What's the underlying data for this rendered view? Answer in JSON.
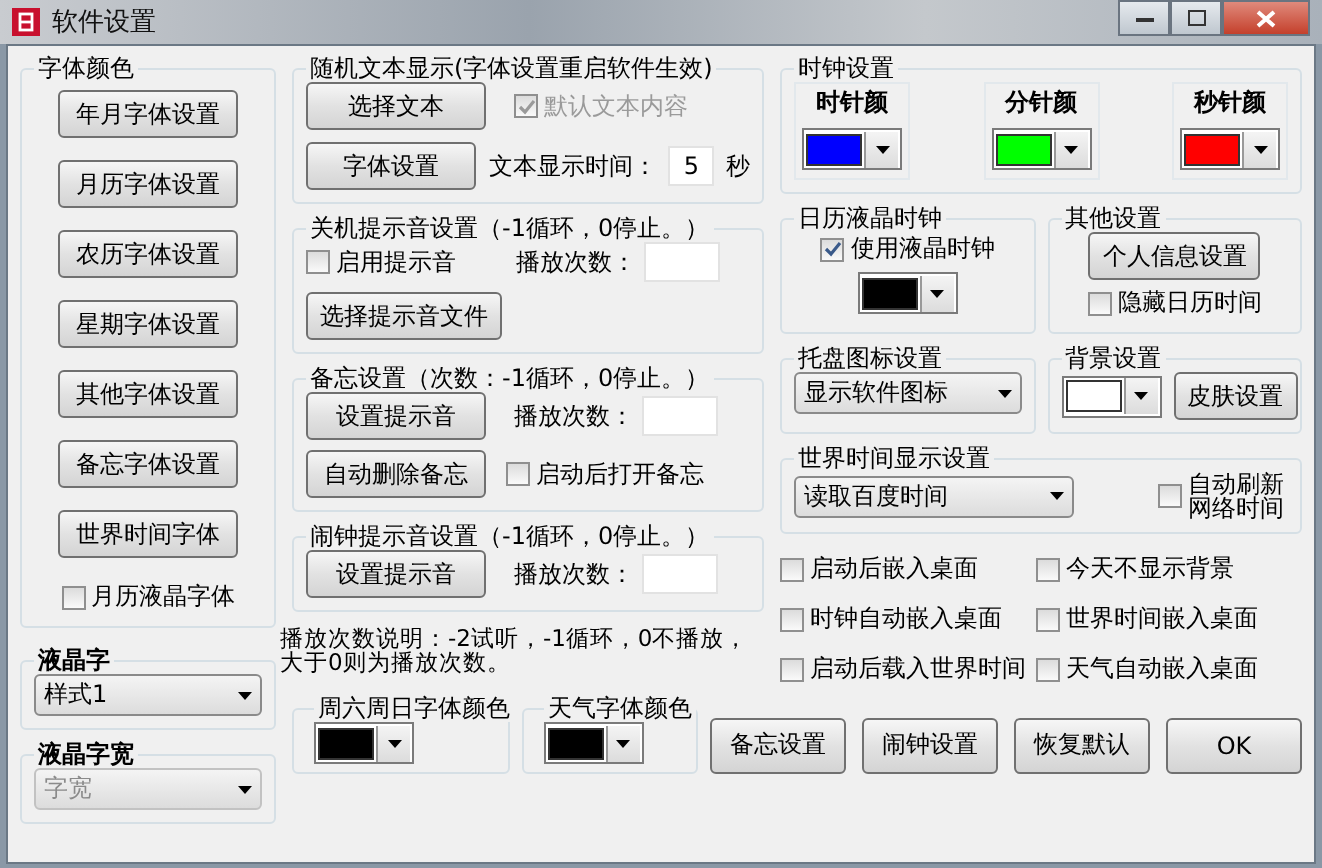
{
  "window": {
    "title": "软件设置"
  },
  "font_color": {
    "title": "字体颜色",
    "buttons": [
      "年月字体设置",
      "月历字体设置",
      "农历字体设置",
      "星期字体设置",
      "其他字体设置",
      "备忘字体设置",
      "世界时间字体"
    ],
    "checkbox": {
      "label": "月历液晶字体",
      "checked": false
    }
  },
  "lcd_style": {
    "title": "液晶字",
    "value": "样式1"
  },
  "lcd_width": {
    "title": "液晶字宽",
    "value": "字宽",
    "disabled": true
  },
  "random_text": {
    "title": "随机文本显示(字体设置重启软件生效)",
    "select_button": "选择文本",
    "font_button": "字体设置",
    "checkbox": {
      "label": "默认文本内容",
      "checked": true,
      "disabled": true
    },
    "time_label": "文本显示时间：",
    "time_value": "5",
    "unit": "秒"
  },
  "shutdown_sound": {
    "title": "关机提示音设置（-1循环，0停止。）",
    "checkbox": {
      "label": "启用提示音",
      "checked": false
    },
    "count_label": "播放次数：",
    "file_button": "选择提示音文件"
  },
  "memo": {
    "title": "备忘设置（次数：-1循环，0停止。）",
    "sound_button": "设置提示音",
    "count_label": "播放次数：",
    "delete_button": "自动删除备忘",
    "checkbox": {
      "label": "启动后打开备忘",
      "checked": false
    }
  },
  "alarm": {
    "title": "闹钟提示音设置（-1循环，0停止。）",
    "sound_button": "设置提示音",
    "count_label": "播放次数："
  },
  "note": "播放次数说明：-2试听，-1循环，0不播放，大于0则为播放次数。",
  "weekend_color": {
    "title": "周六周日字体颜色",
    "color": "#000000"
  },
  "weather_color": {
    "title": "天气字体颜色",
    "color": "#000000"
  },
  "clock": {
    "title": "时钟设置",
    "hands": [
      {
        "label": "时针颜",
        "color": "#0000ff"
      },
      {
        "label": "分针颜",
        "color": "#00ff00"
      },
      {
        "label": "秒针颜",
        "color": "#ff0000"
      }
    ]
  },
  "lcd_clock": {
    "title": "日历液晶时钟",
    "checkbox": {
      "label": "使用液晶时钟",
      "checked": true
    },
    "color": "#000000"
  },
  "other": {
    "title": "其他设置",
    "button": "个人信息设置",
    "checkbox": {
      "label": "隐藏日历时间",
      "checked": false
    }
  },
  "tray": {
    "title": "托盘图标设置",
    "value": "显示软件图标"
  },
  "background": {
    "title": "背景设置",
    "color": "#ffffff",
    "button": "皮肤设置"
  },
  "world_time": {
    "title": "世界时间显示设置",
    "value": "读取百度时间",
    "checkbox": {
      "label": "自动刷新网络时间",
      "checked": false
    }
  },
  "options": [
    {
      "label": "启动后嵌入桌面",
      "checked": false
    },
    {
      "label": "今天不显示背景",
      "checked": false
    },
    {
      "label": "时钟自动嵌入桌面",
      "checked": false
    },
    {
      "label": "世界时间嵌入桌面",
      "checked": false
    },
    {
      "label": "启动后载入世界时间",
      "checked": false
    },
    {
      "label": "天气自动嵌入桌面",
      "checked": false
    }
  ],
  "footer_buttons": [
    "备忘设置",
    "闹钟设置",
    "恢复默认",
    "OK"
  ]
}
